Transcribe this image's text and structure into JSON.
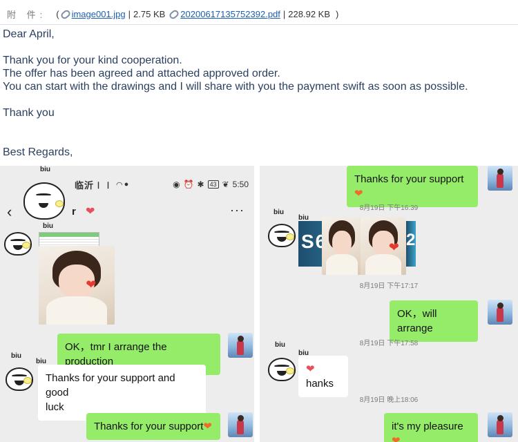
{
  "email": {
    "attachment_label": "附 件:",
    "attachments": [
      {
        "name": "image001.jpg",
        "size": "2.75 KB"
      },
      {
        "name": "20200617135752392.pdf",
        "size": "228.92 KB"
      }
    ],
    "greeting": "Dear April,",
    "line1": "Thank you for your kind cooperation.",
    "line2": "The offer has been agreed and attached approved order.",
    "line3": "You can start with the drawings and I will share with you the payment swift as soon as possible.",
    "thanks": "Thank you",
    "closing": "Best Regards,"
  },
  "left_chat": {
    "status": {
      "carrier": "临沂∣∣",
      "time": "5:50",
      "battery": "43"
    },
    "contact_suffix": "r",
    "biu_label": "biu",
    "messages": {
      "ok_production": "OK，tmr I arrange the production",
      "thanks_good_luck_1": "Thanks for your support and good",
      "thanks_good_luck_2": "luck",
      "thanks_support": "Thanks for your support"
    }
  },
  "right_chat": {
    "biu_label": "biu",
    "banner_text": "S6",
    "banner_suffix": "2",
    "messages": {
      "thanks_support": "Thanks for your support",
      "ok_arrange": "OK，will arrange",
      "hanks": "hanks",
      "pleasure": "it's my pleasure"
    },
    "timestamps": [
      "8月19日 下午16:39",
      "8月19日 下午17:17",
      "8月19日 下午17:58",
      "8月19日 晚上18:06"
    ]
  },
  "icons": {
    "heart": "❤",
    "more": "···",
    "back": "‹"
  },
  "colors": {
    "sent_bubble": "#95ec69",
    "received_bubble": "#ffffff",
    "chat_bg": "#ededed",
    "link": "#1a5fb4",
    "email_text": "#2a3f5f"
  }
}
